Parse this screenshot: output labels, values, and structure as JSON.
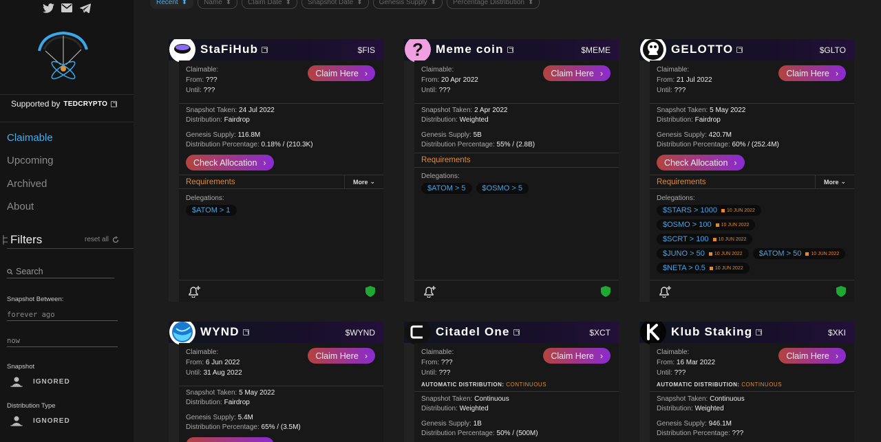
{
  "sidebar": {
    "supported_by": "Supported by",
    "sponsor": "TEDCRYPTO",
    "nav": [
      "Claimable",
      "Upcoming",
      "Archived",
      "About"
    ],
    "filters_title": "Filters",
    "reset_all": "reset all",
    "search_placeholder": "Search",
    "snapshot_between": "Snapshot Between:",
    "from_placeholder": "forever ago",
    "to_placeholder": "now",
    "snapshot_label": "Snapshot",
    "snapshot_value": "IGNORED",
    "distribution_type_label": "Distribution Type",
    "distribution_type_value": "IGNORED"
  },
  "sortbar": [
    "Recent",
    "Name",
    "Claim Date",
    "Snapshot Date",
    "Genesis Supply",
    "Percentage Distribution"
  ],
  "labels": {
    "claimable": "Claimable:",
    "from": "From:",
    "until": "Until:",
    "claim_here": "Claim Here",
    "snapshot_taken": "Snapshot Taken:",
    "distribution": "Distribution:",
    "genesis_supply": "Genesis Supply:",
    "distribution_percentage": "Distribution Percentage:",
    "check_allocation": "Check Allocation",
    "requirements": "Requirements",
    "more": "More",
    "delegations": "Delegations:",
    "auto_distribution": "AUTOMATIC DISTRIBUTION:",
    "continuous": "CONTINUOUS"
  },
  "cards": [
    {
      "name": "StaFiHub",
      "ticker": "$FIS",
      "from": "???",
      "until": "???",
      "snapshot": "24 Jul 2022",
      "distribution": "Fairdrop",
      "genesis": "116.8M",
      "percentage": "0.18% / (210.3K)",
      "delegations": [
        [
          "$ATOM > 1",
          ""
        ]
      ]
    },
    {
      "name": "Meme coin",
      "ticker": "$MEME",
      "from": "20 Apr 2022",
      "until": "???",
      "snapshot": "2 Apr 2022",
      "distribution": "Weighted",
      "genesis": "5B",
      "percentage": "55% / (2.8B)",
      "delegations": [
        [
          "$ATOM > 5",
          ""
        ],
        [
          "$OSMO > 5",
          ""
        ]
      ]
    },
    {
      "name": "GELOTTO",
      "ticker": "$GLTO",
      "from": "21 Jul 2022",
      "until": "???",
      "snapshot": "5 May 2022",
      "distribution": "Fairdrop",
      "genesis": "420.7M",
      "percentage": "60% / (252.4M)",
      "delegations": [
        [
          "$STARS > 1000",
          "10 JUN 2022"
        ],
        [
          "$OSMO > 100",
          "10 JUN 2022"
        ],
        [
          "$SCRT > 100",
          "10 JUN 2022"
        ],
        [
          "$JUNO > 50",
          "10 JUN 2022"
        ],
        [
          "$ATOM > 50",
          "10 JUN 2022"
        ],
        [
          "$NETA > 0.5",
          "10 JUN 2022"
        ]
      ]
    },
    {
      "name": "WYND",
      "ticker": "$WYND",
      "from": "6 Jun 2022",
      "until": "31 Aug 2022",
      "snapshot": "5 May 2022",
      "distribution": "Fairdrop",
      "genesis": "5.4M",
      "percentage": "65% / (3.5M)"
    },
    {
      "name": "Citadel One",
      "ticker": "$XCT",
      "from": "???",
      "until": "???",
      "snapshot": "Continuous",
      "distribution": "Weighted",
      "genesis": "1B",
      "percentage": "50% / (500M)"
    },
    {
      "name": "Klub Staking",
      "ticker": "$XKI",
      "from": "16 Mar 2022",
      "until": "???",
      "snapshot": "Continuous",
      "distribution": "Weighted",
      "genesis": "946.1M",
      "percentage": "???"
    }
  ]
}
